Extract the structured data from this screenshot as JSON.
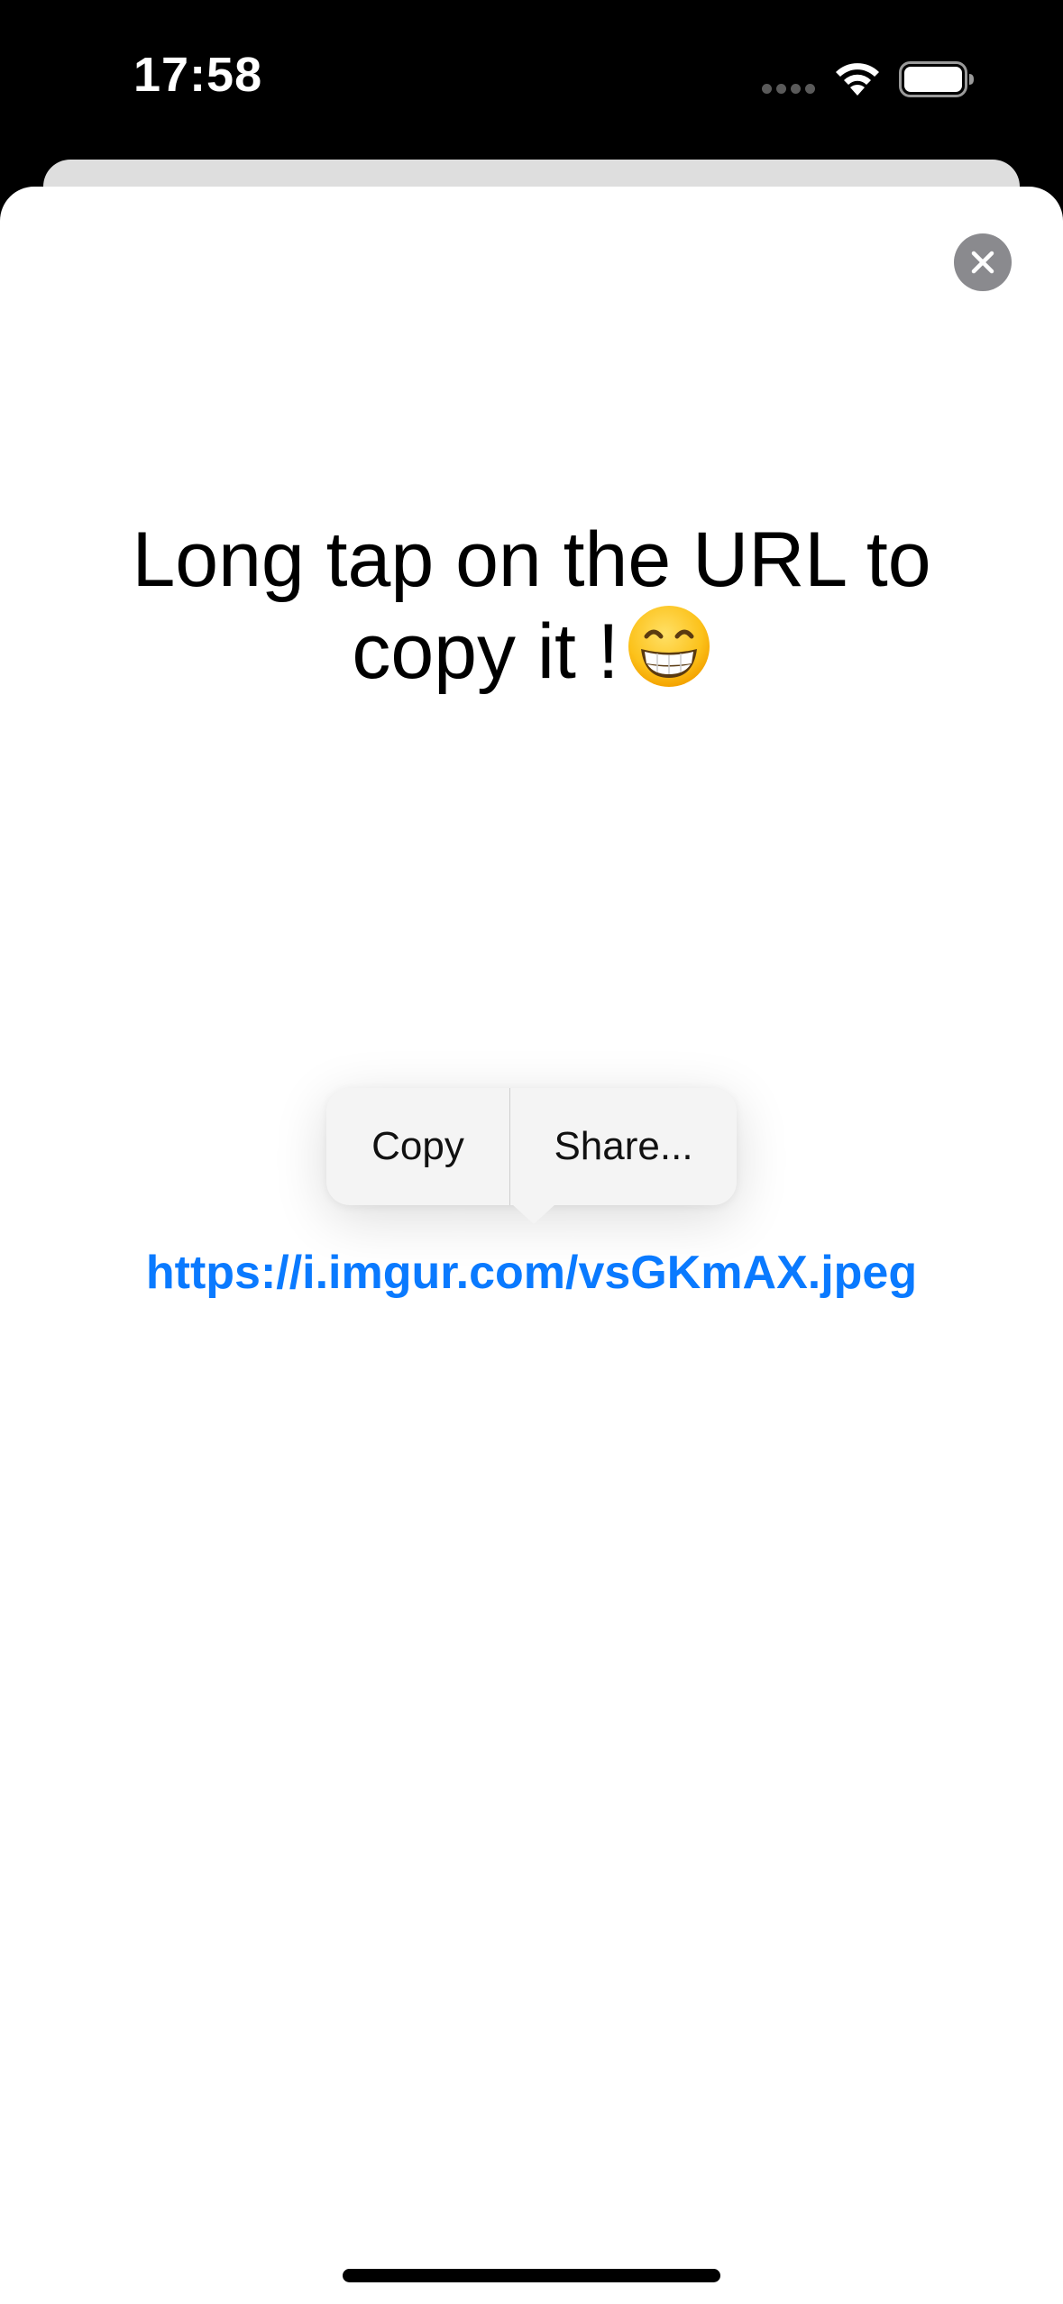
{
  "status_bar": {
    "time": "17:58",
    "wifi_icon": "wifi-icon",
    "battery_icon": "battery-icon"
  },
  "modal": {
    "close_icon": "close-icon",
    "headline": "Long tap on the URL to copy it !",
    "headline_emoji": "grinning-face-icon",
    "url": "https://i.imgur.com/vsGKmAX.jpeg",
    "link_color": "#0a7aff"
  },
  "context_menu": {
    "copy_label": "Copy",
    "share_label": "Share..."
  }
}
